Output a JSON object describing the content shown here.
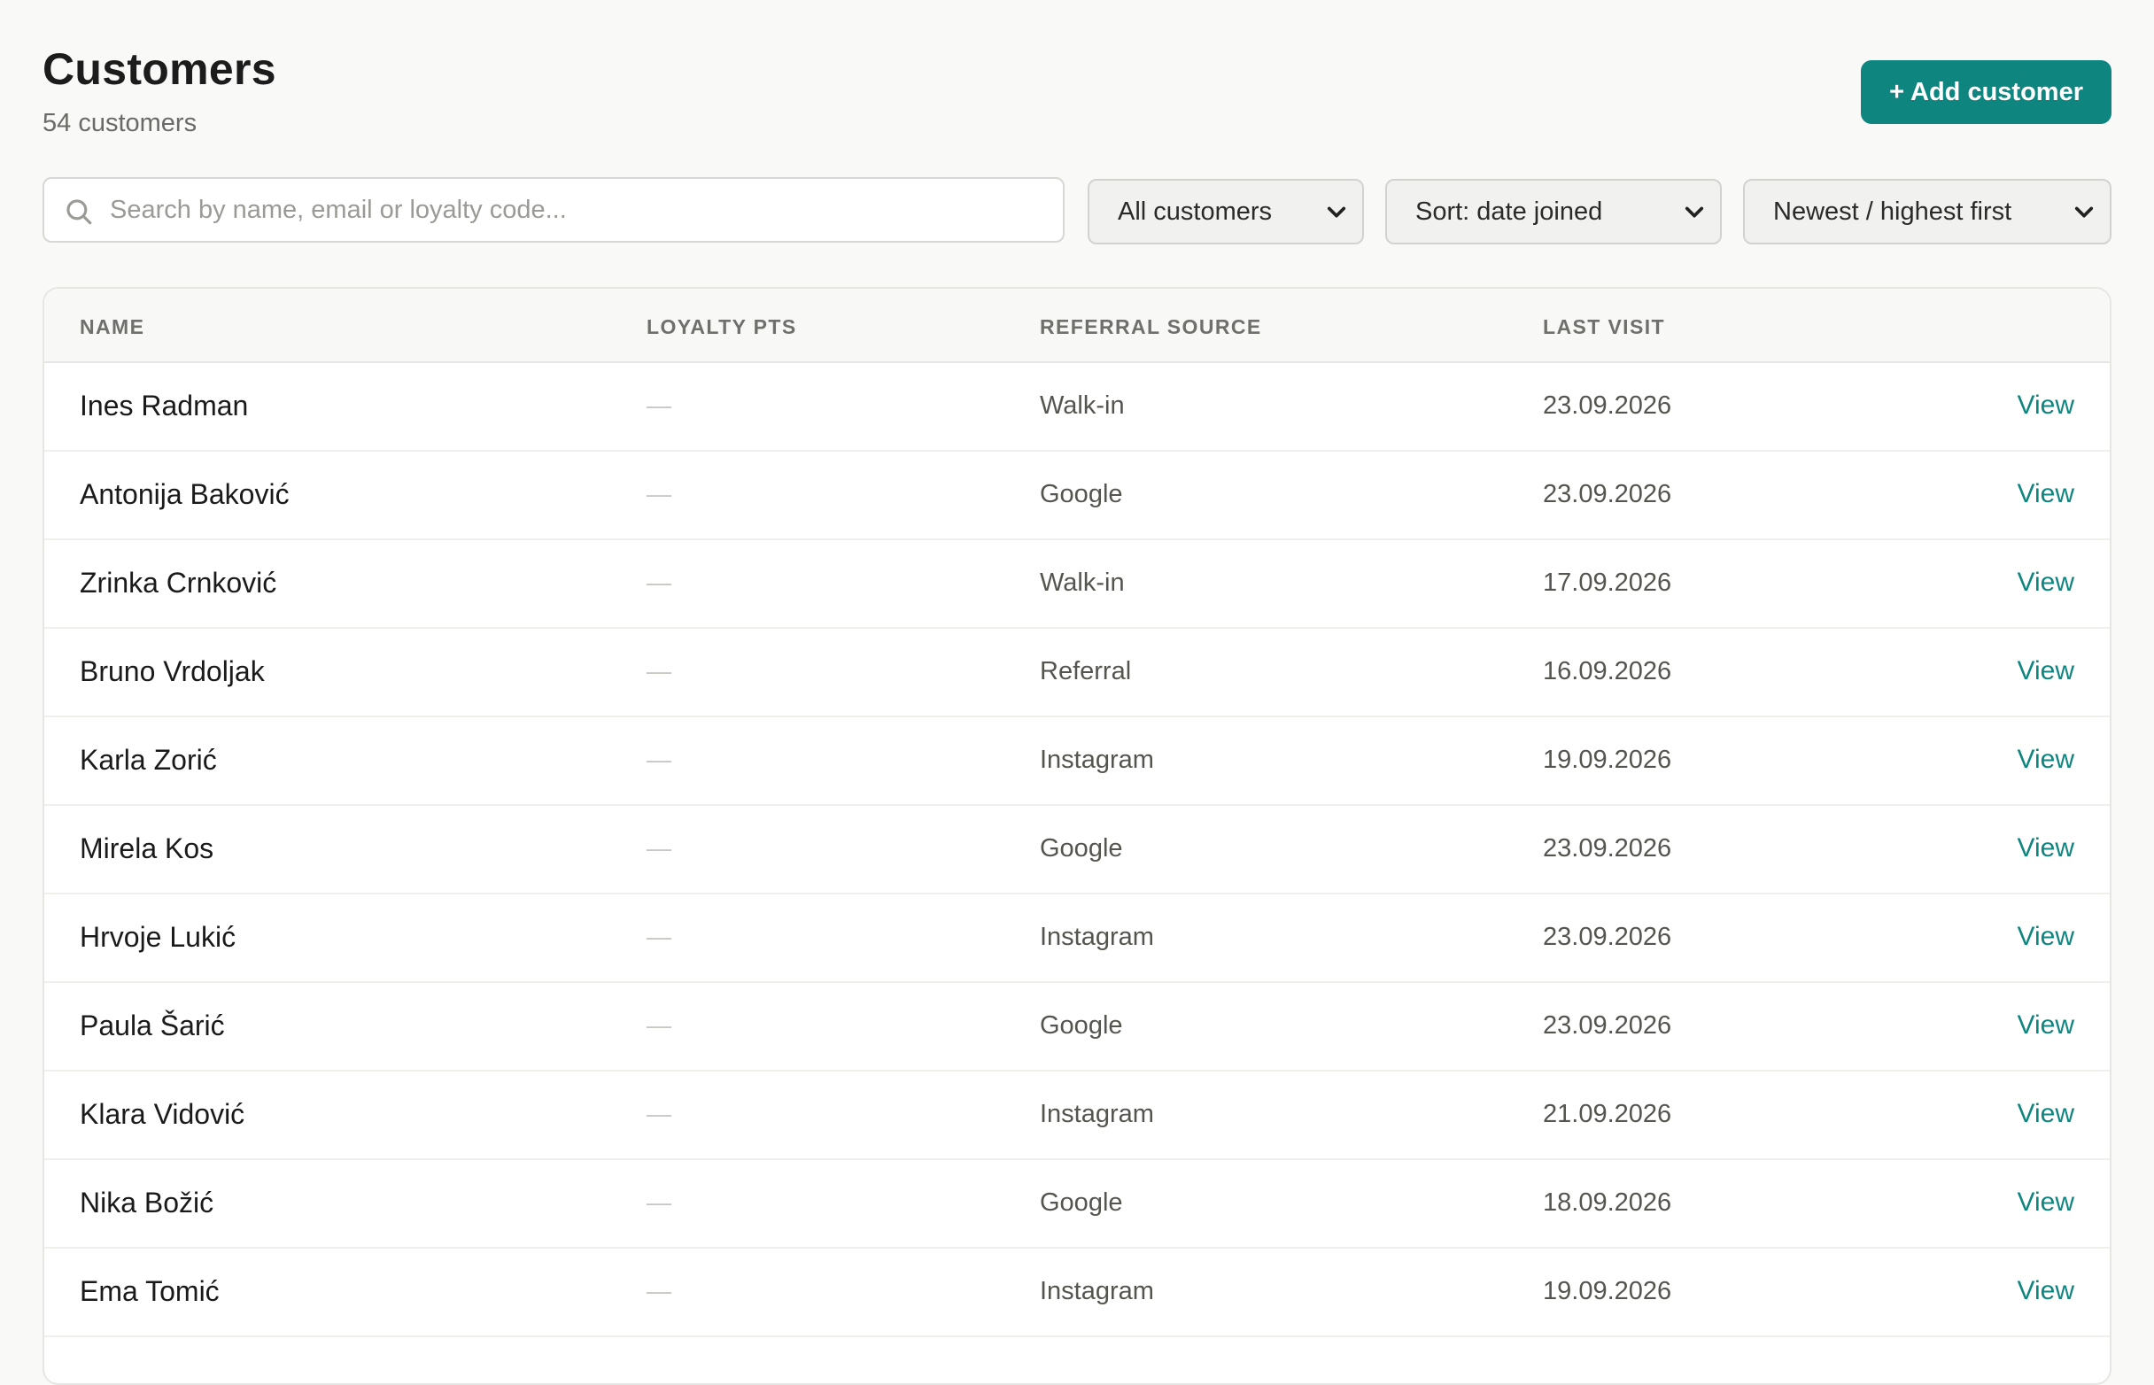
{
  "page": {
    "title": "Customers",
    "subtitle": "54 customers",
    "add_button": "+ Add customer"
  },
  "toolbar": {
    "search_placeholder": "Search by name, email or loyalty code...",
    "filter_selected": "All customers",
    "sort_selected": "Sort: date joined",
    "order_selected": "Newest / highest first"
  },
  "table": {
    "columns": {
      "name": "NAME",
      "loyalty": "LOYALTY PTS",
      "source": "REFERRAL SOURCE",
      "last_visit": "LAST VISIT"
    },
    "rows": [
      {
        "name": "Ines Radman",
        "points": "—",
        "source": "Walk-in",
        "last_visit": "23.09.2026",
        "action": "View"
      },
      {
        "name": "Antonija Baković",
        "points": "—",
        "source": "Google",
        "last_visit": "23.09.2026",
        "action": "View"
      },
      {
        "name": "Zrinka Crnković",
        "points": "—",
        "source": "Walk-in",
        "last_visit": "17.09.2026",
        "action": "View"
      },
      {
        "name": "Bruno Vrdoljak",
        "points": "—",
        "source": "Referral",
        "last_visit": "16.09.2026",
        "action": "View"
      },
      {
        "name": "Karla Zorić",
        "points": "—",
        "source": "Instagram",
        "last_visit": "19.09.2026",
        "action": "View"
      },
      {
        "name": "Mirela Kos",
        "points": "—",
        "source": "Google",
        "last_visit": "23.09.2026",
        "action": "View"
      },
      {
        "name": "Hrvoje Lukić",
        "points": "—",
        "source": "Instagram",
        "last_visit": "23.09.2026",
        "action": "View"
      },
      {
        "name": "Paula Šarić",
        "points": "—",
        "source": "Google",
        "last_visit": "23.09.2026",
        "action": "View"
      },
      {
        "name": "Klara Vidović",
        "points": "—",
        "source": "Instagram",
        "last_visit": "21.09.2026",
        "action": "View"
      },
      {
        "name": "Nika Božić",
        "points": "—",
        "source": "Google",
        "last_visit": "18.09.2026",
        "action": "View"
      },
      {
        "name": "Ema Tomić",
        "points": "—",
        "source": "Instagram",
        "last_visit": "19.09.2026",
        "action": "View"
      }
    ]
  },
  "colors": {
    "accent": "#0f8580",
    "background": "#f9f9f8"
  },
  "icons": {
    "search": "search-icon",
    "select": "chevron-down-icon"
  }
}
